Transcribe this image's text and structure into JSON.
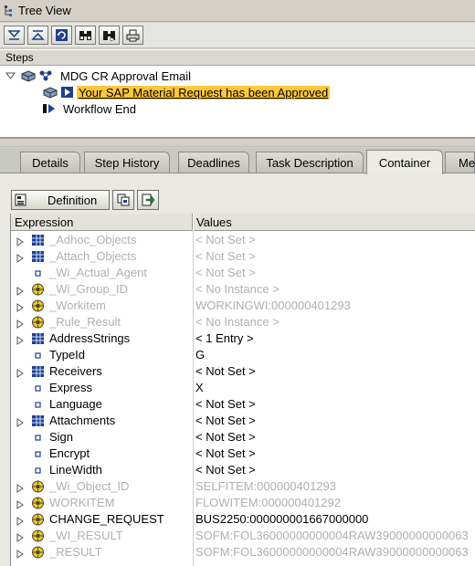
{
  "window": {
    "title": "Tree View"
  },
  "toolbar": {
    "buttons": [
      "expand-all-icon",
      "collapse-all-icon",
      "refresh-icon",
      "find-icon",
      "find-next-icon",
      "print-icon"
    ]
  },
  "steps": {
    "header": "Steps",
    "items": [
      {
        "label": "MDG CR Approval Email",
        "level": 0,
        "icon": "workflow-icon"
      },
      {
        "label": "Your SAP Material Request has been Approved",
        "level": 1,
        "icon": "step-execute-icon",
        "selected": true
      },
      {
        "label": "Workflow End",
        "level": 1,
        "icon": "workflow-end-icon"
      }
    ]
  },
  "tabs": [
    "Details",
    "Step History",
    "Deadlines",
    "Task Description",
    "Container",
    "Me"
  ],
  "active_tab": "Container",
  "container": {
    "definition_label": "Definition",
    "columns": [
      "Expression",
      "Values"
    ],
    "rows": [
      {
        "name": "_Adhoc_Objects",
        "value": "< Not Set >",
        "icon": "table-icon",
        "expandable": true,
        "dim": true
      },
      {
        "name": "_Attach_Objects",
        "value": "< Not Set >",
        "icon": "table-icon",
        "expandable": true,
        "dim": true
      },
      {
        "name": "_Wi_Actual_Agent",
        "value": "< Not Set >",
        "icon": "field-icon",
        "expandable": false,
        "dim": true
      },
      {
        "name": "_Wi_Group_ID",
        "value": "< No Instance >",
        "icon": "object-icon",
        "expandable": true,
        "dim": true
      },
      {
        "name": "_Workitem",
        "value": "WORKINGWI:000000401293",
        "icon": "object-icon",
        "expandable": true,
        "dim": true
      },
      {
        "name": "_Rule_Result",
        "value": "< No Instance >",
        "icon": "object-icon",
        "expandable": true,
        "dim": true
      },
      {
        "name": "AddressStrings",
        "value": "< 1 Entry >",
        "icon": "table-icon",
        "expandable": true,
        "dim": false
      },
      {
        "name": "TypeId",
        "value": "G",
        "icon": "field-icon",
        "expandable": false,
        "dim": false
      },
      {
        "name": "Receivers",
        "value": "< Not Set >",
        "icon": "table-icon",
        "expandable": true,
        "dim": false
      },
      {
        "name": "Express",
        "value": "X",
        "icon": "field-icon",
        "expandable": false,
        "dim": false
      },
      {
        "name": "Language",
        "value": "< Not Set >",
        "icon": "field-icon",
        "expandable": false,
        "dim": false
      },
      {
        "name": "Attachments",
        "value": "< Not Set >",
        "icon": "table-icon",
        "expandable": true,
        "dim": false
      },
      {
        "name": "Sign",
        "value": "< Not Set >",
        "icon": "field-icon",
        "expandable": false,
        "dim": false
      },
      {
        "name": "Encrypt",
        "value": "< Not Set >",
        "icon": "field-icon",
        "expandable": false,
        "dim": false
      },
      {
        "name": "LineWidth",
        "value": "< Not Set >",
        "icon": "field-icon",
        "expandable": false,
        "dim": false
      },
      {
        "name": "_Wi_Object_ID",
        "value": "SELFITEM:000000401293",
        "icon": "object-icon",
        "expandable": true,
        "dim": true
      },
      {
        "name": "WORKITEM",
        "value": "FLOWITEM:000000401292",
        "icon": "object-icon",
        "expandable": true,
        "dim": true
      },
      {
        "name": "CHANGE_REQUEST",
        "value": "BUS2250:000000001667000000",
        "icon": "object-icon",
        "expandable": true,
        "dim": false
      },
      {
        "name": "_WI_RESULT",
        "value": "SOFM:FOL36000000000004RAW39000000000063",
        "icon": "object-icon",
        "expandable": true,
        "dim": true
      },
      {
        "name": "_RESULT",
        "value": "SOFM:FOL36000000000004RAW39000000000063",
        "icon": "object-icon",
        "expandable": true,
        "dim": true
      }
    ]
  }
}
